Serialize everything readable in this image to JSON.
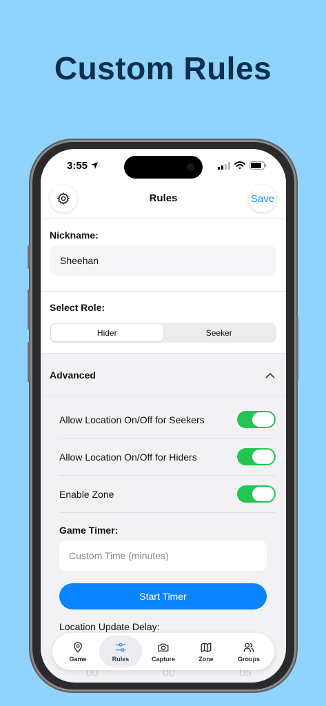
{
  "promo": {
    "title": "Custom Rules"
  },
  "status_bar": {
    "time": "3:55"
  },
  "nav": {
    "title": "Rules",
    "save_label": "Save"
  },
  "form": {
    "nickname_label": "Nickname:",
    "nickname_value": "Sheehan",
    "role_label": "Select Role:",
    "roles": [
      "Hider",
      "Seeker"
    ],
    "selected_role": "Hider"
  },
  "advanced": {
    "title": "Advanced",
    "settings": [
      {
        "label": "Allow Location On/Off for Seekers",
        "enabled": true
      },
      {
        "label": "Allow Location On/Off for Hiders",
        "enabled": true
      },
      {
        "label": "Enable Zone",
        "enabled": true
      }
    ],
    "timer_label": "Game Timer:",
    "timer_placeholder": "Custom Time (minutes)",
    "start_button": "Start Timer",
    "delay_label": "Location Update Delay:",
    "picker_values": [
      "00",
      "00",
      "05"
    ]
  },
  "tabbar": {
    "items": [
      {
        "label": "Game",
        "icon": "map-pin-icon"
      },
      {
        "label": "Rules",
        "icon": "sliders-icon"
      },
      {
        "label": "Capture",
        "icon": "camera-icon"
      },
      {
        "label": "Zone",
        "icon": "map-icon"
      },
      {
        "label": "Groups",
        "icon": "users-icon"
      }
    ],
    "active": "Rules"
  },
  "colors": {
    "background": "#8fd3fe",
    "accent": "#0a84ff",
    "toggle_on": "#22c553",
    "title": "#0b2f4e"
  }
}
